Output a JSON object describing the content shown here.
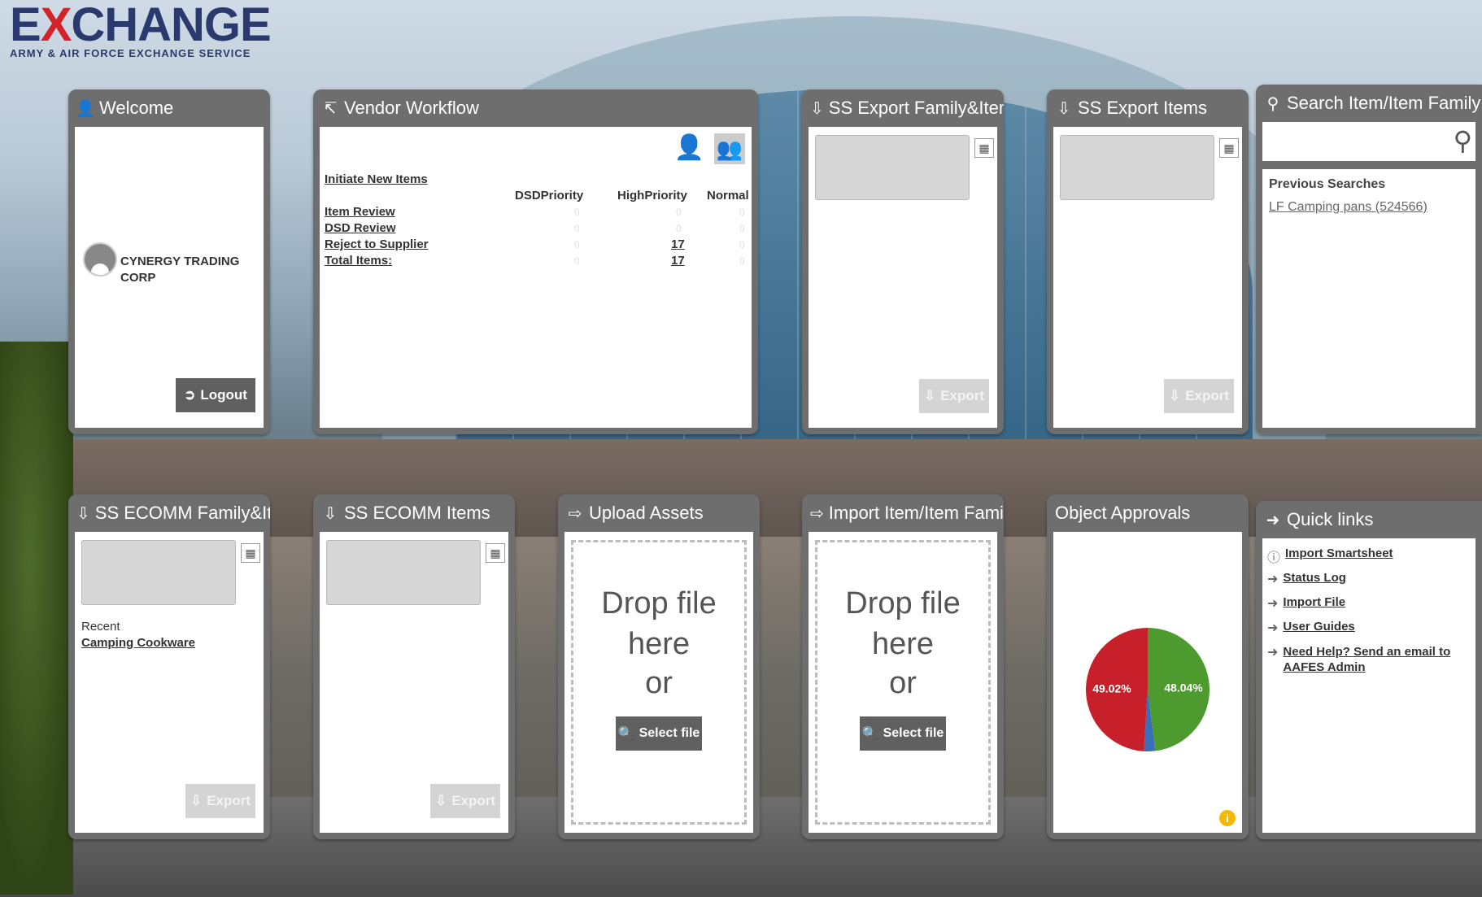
{
  "logo": {
    "title_prefix": "E",
    "title_x": "X",
    "title_rest": "CHANGE",
    "subtitle": "ARMY & AIR FORCE EXCHANGE SERVICE"
  },
  "welcome": {
    "title": "Welcome",
    "user_line1": "CYNERGY TRADING",
    "user_line2": "CORP",
    "logout_label": "Logout"
  },
  "vendor_workflow": {
    "title": "Vendor Workflow",
    "initiate_label": "Initiate New Items",
    "columns": [
      "DSDPriority",
      "HighPriority",
      "Normal"
    ],
    "rows": [
      {
        "label": "Item Review",
        "values": [
          "0",
          "0",
          "0"
        ]
      },
      {
        "label": "DSD Review",
        "values": [
          "0",
          "0",
          "0"
        ]
      },
      {
        "label": "Reject to Supplier",
        "values": [
          "0",
          "17",
          "0"
        ]
      },
      {
        "label": "Total Items:",
        "values": [
          "0",
          "17",
          "0"
        ]
      }
    ]
  },
  "ss_export_family": {
    "title": "SS Export Family&Items",
    "export_label": "Export"
  },
  "ss_export_items": {
    "title": "SS Export Items",
    "export_label": "Export"
  },
  "search": {
    "title": "Search Item/Item Family",
    "placeholder": "",
    "previous_label": "Previous Searches",
    "previous_items": [
      "LF Camping pans (524566)"
    ]
  },
  "ss_ecomm_family": {
    "title": "SS ECOMM Family&Iten",
    "recent_label": "Recent",
    "recent_item": "Camping Cookware",
    "export_label": "Export"
  },
  "ss_ecomm_items": {
    "title": "SS ECOMM Items",
    "export_label": "Export"
  },
  "upload_assets": {
    "title": "Upload Assets",
    "drop_text": "Drop file here",
    "or_text": "or",
    "select_label": "Select file"
  },
  "import_item": {
    "title": "Import Item/Item Family",
    "drop_text": "Drop file here",
    "or_text": "or",
    "select_label": "Select file"
  },
  "object_approvals": {
    "title": "Object Approvals",
    "label_red": "49.02%",
    "label_green": "48.04%",
    "colors": {
      "red": "#c8202a",
      "green": "#4d9a2e",
      "blue": "#3a6fb8"
    }
  },
  "quick_links": {
    "title": "Quick links",
    "items": [
      {
        "label": "Import Smartsheet",
        "icon": "help-circle-icon"
      },
      {
        "label": "Status Log",
        "icon": "arrow-right-icon"
      },
      {
        "label": "Import File",
        "icon": "arrow-right-icon"
      },
      {
        "label": "User Guides",
        "icon": "arrow-right-icon"
      },
      {
        "label": "Need Help? Send an email to AAFES Admin",
        "icon": "arrow-right-icon"
      }
    ]
  },
  "chart_data": {
    "type": "pie",
    "title": "",
    "slices": [
      {
        "label": "49.02%",
        "value": 49.02,
        "color": "#c8202a"
      },
      {
        "label": "48.04%",
        "value": 48.04,
        "color": "#4d9a2e"
      },
      {
        "label": "",
        "value": 2.94,
        "color": "#3a6fb8"
      }
    ]
  }
}
